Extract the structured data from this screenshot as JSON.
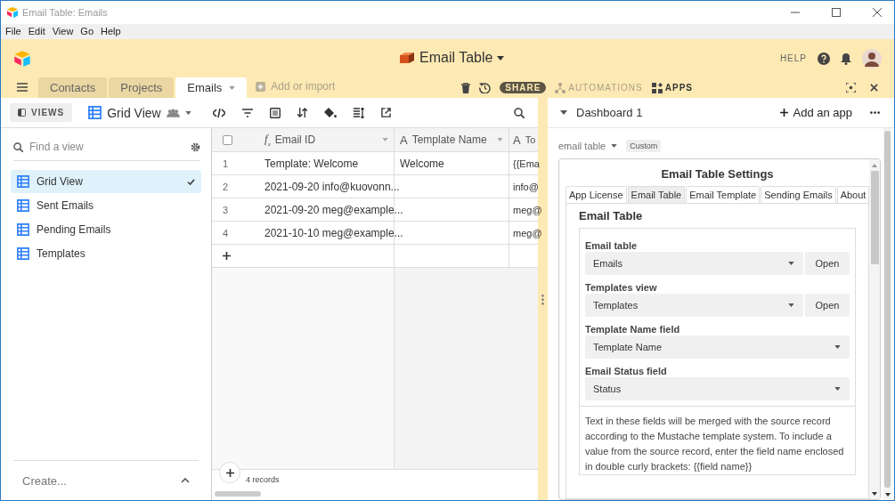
{
  "window": {
    "title": "Email Table: Emails"
  },
  "menu": [
    "File",
    "Edit",
    "View",
    "Go",
    "Help"
  ],
  "base": {
    "name": "Email Table",
    "help": "HELP"
  },
  "tabs": [
    {
      "label": "Contacts",
      "selected": false
    },
    {
      "label": "Projects",
      "selected": false
    },
    {
      "label": "Emails",
      "selected": true
    }
  ],
  "add_table": "Add or import",
  "actions": {
    "share": "SHARE",
    "automations": "AUTOMATIONS",
    "apps": "APPS"
  },
  "toolbar": {
    "views": "VIEWS",
    "view_name": "Grid View"
  },
  "sidebar": {
    "search_placeholder": "Find a view",
    "items": [
      {
        "label": "Grid View",
        "selected": true
      },
      {
        "label": "Sent Emails",
        "selected": false
      },
      {
        "label": "Pending Emails",
        "selected": false
      },
      {
        "label": "Templates",
        "selected": false
      }
    ],
    "create": "Create..."
  },
  "table": {
    "header_checked": false,
    "columns": [
      {
        "kind": "formula",
        "icon": "f$_{x}$",
        "label": "Email ID"
      },
      {
        "kind": "text",
        "icon": "A",
        "label": "Template Name"
      },
      {
        "kind": "text",
        "icon": "A",
        "label": "To"
      }
    ],
    "rows": [
      {
        "number": "1",
        "cells": [
          "Template: Welcome",
          "Welcome",
          "{{Ema"
        ]
      },
      {
        "number": "2",
        "cells": [
          "2021-09-20 info@kuovonn...",
          "",
          "info@"
        ]
      },
      {
        "number": "3",
        "cells": [
          "2021-09-20 meg@example...",
          "",
          "meg@"
        ]
      },
      {
        "number": "4",
        "cells": [
          "2021-10-10 meg@example...",
          "",
          "meg@"
        ]
      }
    ],
    "footer": "4 records"
  },
  "dashboard": {
    "title": "Dashboard 1",
    "add_app": "Add an app",
    "table_label": "email table",
    "badge": "Custom",
    "settings_title": "Email Table Settings",
    "settings_tabs": [
      {
        "label": "App License",
        "selected": false
      },
      {
        "label": "Email Table",
        "selected": true
      },
      {
        "label": "Email Template",
        "selected": false
      },
      {
        "label": "Sending Emails",
        "selected": false
      },
      {
        "label": "About",
        "selected": false
      }
    ],
    "section_title": "Email Table",
    "fields": [
      {
        "label": "Email table",
        "value": "Emails",
        "button": "Open"
      },
      {
        "label": "Templates view",
        "value": "Templates",
        "button": "Open"
      },
      {
        "label": "Template Name field",
        "value": "Template Name"
      },
      {
        "label": "Email Status field",
        "value": "Status"
      }
    ],
    "note": "Text in these fields will be merged with the source record according to the Mustache template system. To include a value from the source record, enter the field name enclosed in double curly brackets: {{field name}}"
  }
}
